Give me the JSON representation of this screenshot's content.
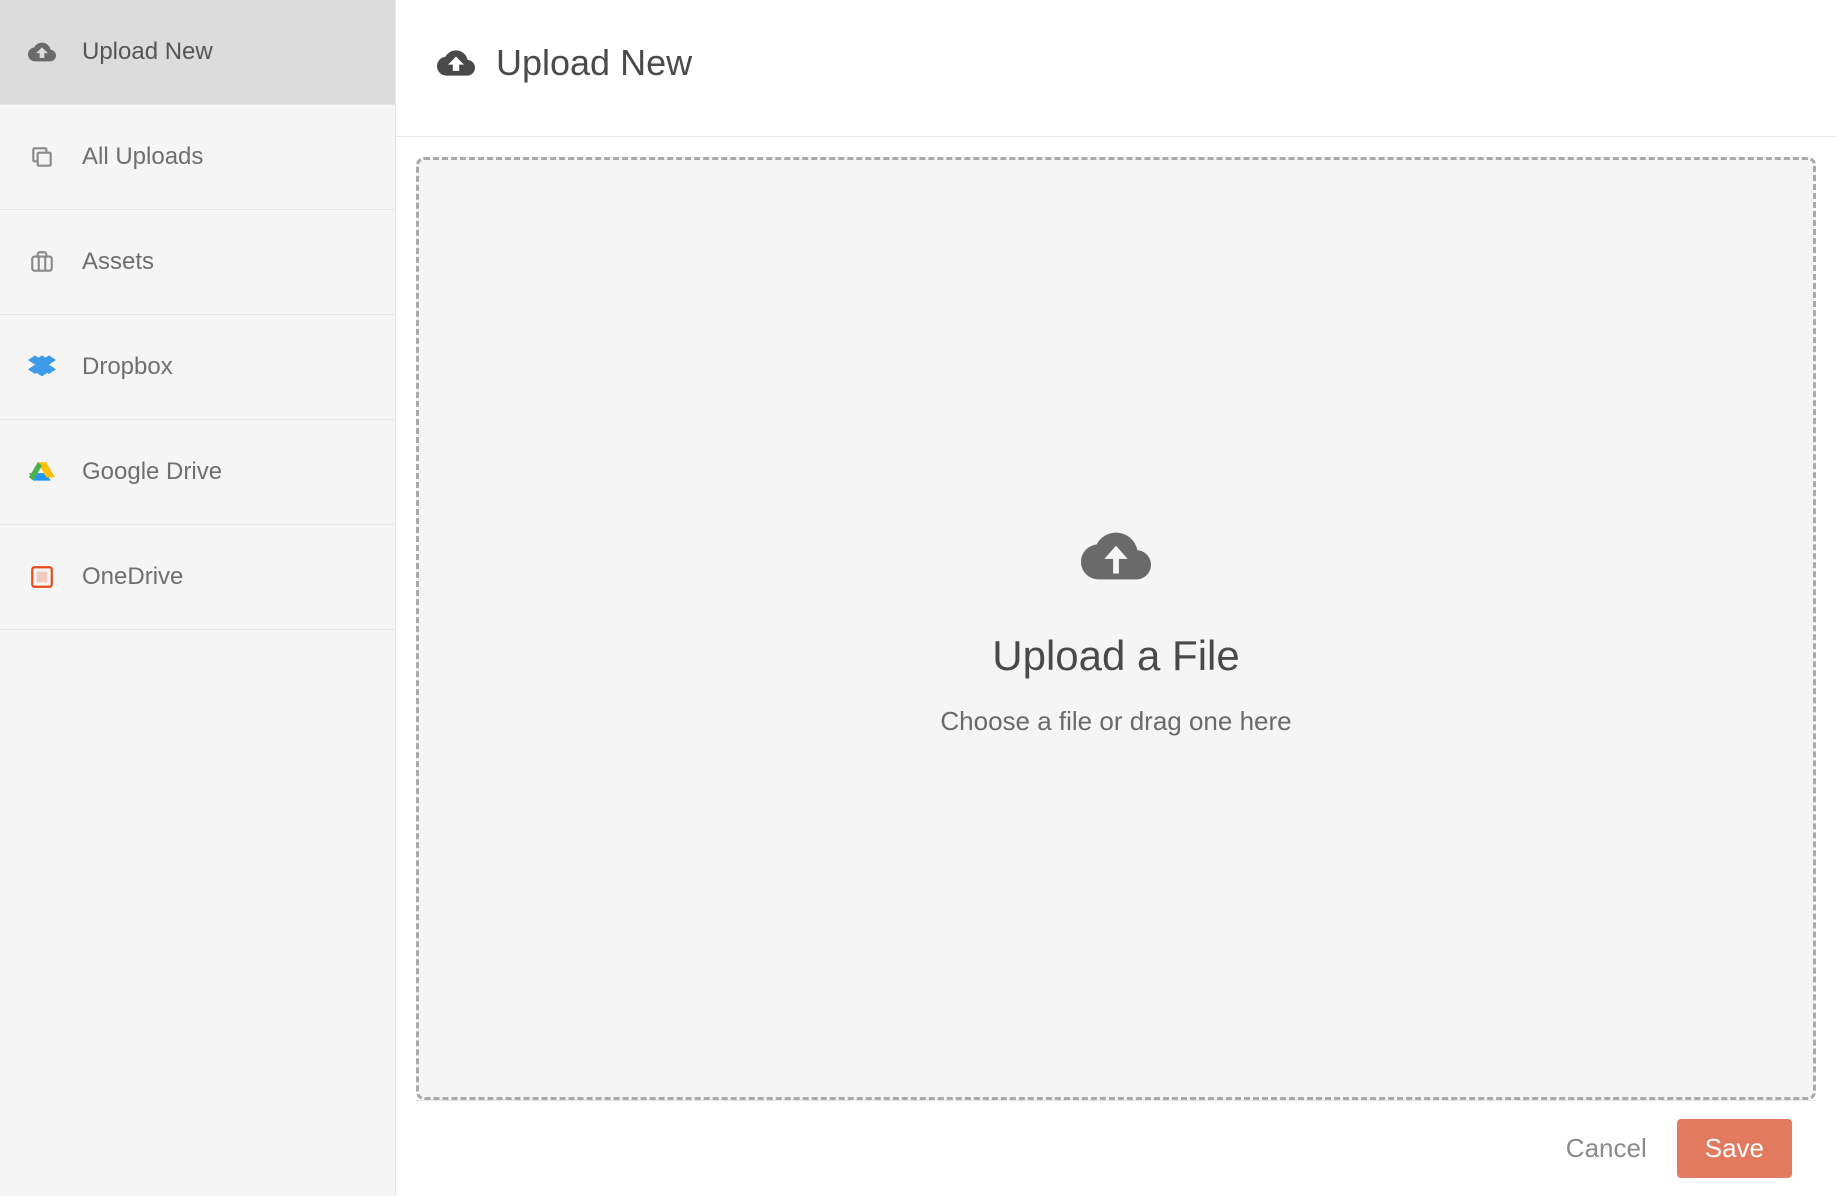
{
  "sidebar": {
    "items": [
      {
        "label": "Upload New"
      },
      {
        "label": "All Uploads"
      },
      {
        "label": "Assets"
      },
      {
        "label": "Dropbox"
      },
      {
        "label": "Google Drive"
      },
      {
        "label": "OneDrive"
      }
    ]
  },
  "header": {
    "title": "Upload New"
  },
  "dropzone": {
    "title": "Upload a File",
    "subtitle": "Choose a file or drag one here"
  },
  "footer": {
    "cancel_label": "Cancel",
    "save_label": "Save"
  }
}
